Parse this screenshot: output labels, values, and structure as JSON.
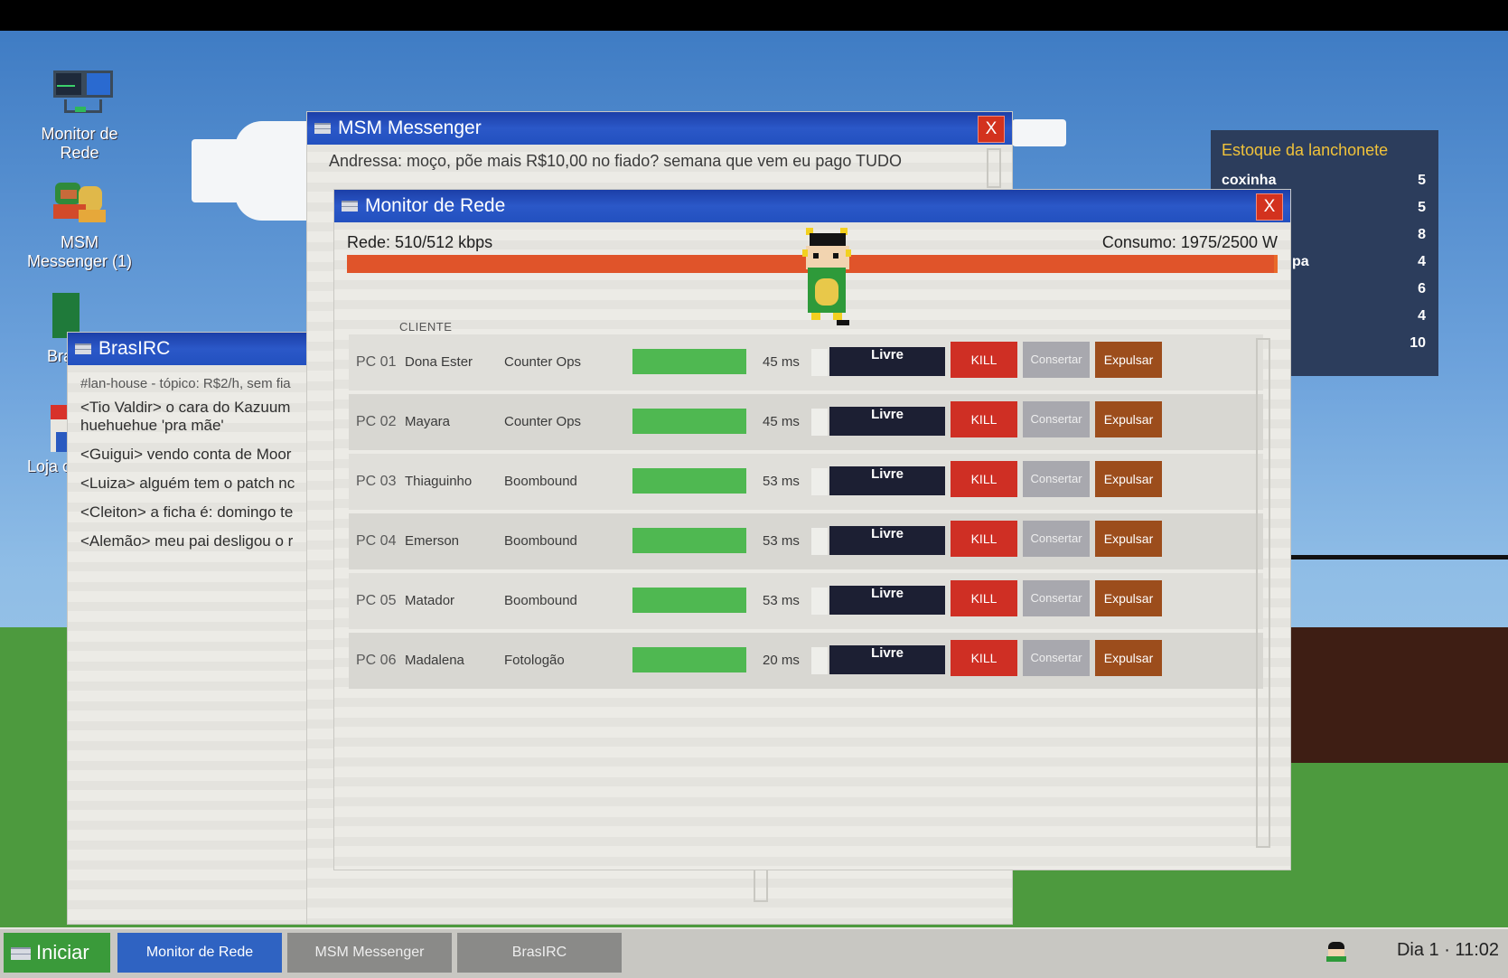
{
  "desktop": {
    "icons": [
      {
        "label": "Monitor de Rede",
        "icon": "network-monitor-icon"
      },
      {
        "label": "MSM Messenger (1)",
        "icon": "messenger-icon"
      },
      {
        "label": "Bra",
        "icon": "irc-icon"
      },
      {
        "label": "Loja c",
        "icon": "store-icon"
      }
    ]
  },
  "irc": {
    "title": "BrasIRC",
    "topic": "#lan-house - tópico: R$2/h, sem fia",
    "lines": [
      "<Tio Valdir> o cara do Kazuum",
      "huehuehue 'pra mãe'",
      "<Guigui> vendo conta de Moor",
      "<Luiza> alguém tem o patch nc",
      "<Cleiton> a ficha é: domingo te",
      "<Alemão> meu pai desligou o r"
    ]
  },
  "messenger": {
    "title": "MSM Messenger",
    "close": "X",
    "message": "Andressa: moço, põe mais R$10,00 no fiado? semana que vem eu pago TUDO"
  },
  "estoque": {
    "title": "Estoque da lanchonete",
    "items": [
      {
        "name": "coxinha",
        "qty": "5"
      },
      {
        "name": "",
        "qty": "5"
      },
      {
        "name": "",
        "qty": "8"
      },
      {
        "name": "pa",
        "qty": "4"
      },
      {
        "name": "",
        "qty": "6"
      },
      {
        "name": "",
        "qty": "4"
      },
      {
        "name": "",
        "qty": "10"
      }
    ]
  },
  "monitor": {
    "title": "Monitor de Rede",
    "close": "X",
    "network_label": "Rede: 510/512 kbps",
    "network_usage": 0.996,
    "power_label": "Consumo: 1975/2500 W",
    "column_client": "CLIENTE",
    "rows": [
      {
        "pc": "PC 01",
        "name": "Dona Ester",
        "game": "Counter Ops",
        "ping": "45 ms",
        "status": "Livre",
        "kill": "KILL",
        "fix": "Consertar",
        "kick": "Expulsar"
      },
      {
        "pc": "PC 02",
        "name": "Mayara",
        "game": "Counter Ops",
        "ping": "45 ms",
        "status": "Livre",
        "kill": "KILL",
        "fix": "Consertar",
        "kick": "Expulsar"
      },
      {
        "pc": "PC 03",
        "name": "Thiaguinho",
        "game": "Boombound",
        "ping": "53 ms",
        "status": "Livre",
        "kill": "KILL",
        "fix": "Consertar",
        "kick": "Expulsar"
      },
      {
        "pc": "PC 04",
        "name": "Emerson",
        "game": "Boombound",
        "ping": "53 ms",
        "status": "Livre",
        "kill": "KILL",
        "fix": "Consertar",
        "kick": "Expulsar"
      },
      {
        "pc": "PC 05",
        "name": "Matador",
        "game": "Boombound",
        "ping": "53 ms",
        "status": "Livre",
        "kill": "KILL",
        "fix": "Consertar",
        "kick": "Expulsar"
      },
      {
        "pc": "PC 06",
        "name": "Madalena",
        "game": "Fotologão",
        "ping": "20 ms",
        "status": "Livre",
        "kill": "KILL",
        "fix": "Consertar",
        "kick": "Expulsar"
      }
    ]
  },
  "taskbar": {
    "start": "Iniciar",
    "buttons": [
      "Monitor de Rede",
      "MSM Messenger",
      "BrasIRC"
    ],
    "clock": "Dia 1 · 11:02"
  },
  "colors": {
    "titlebar": "#2b58c8",
    "kill": "#cf2f24",
    "kick": "#9c4d1c",
    "ping_bar": "#4fb851",
    "network_bar": "#e0542a"
  }
}
